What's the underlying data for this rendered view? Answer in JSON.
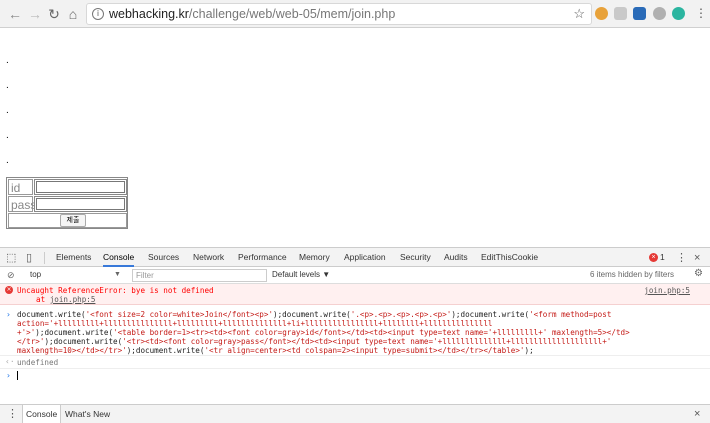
{
  "browser": {
    "url_host": "webhacking.kr",
    "url_path": "/challenge/web/web-05/mem/join.php",
    "back_icon": "arrow-left-icon",
    "forward_icon": "arrow-right-icon",
    "reload_icon": "reload-icon",
    "home_icon": "home-icon",
    "star_icon": "star-icon"
  },
  "page": {
    "dots": [
      ".",
      ".",
      ".",
      ".",
      "."
    ],
    "form": {
      "id_label": "id",
      "pass_label": "pass",
      "submit_label": "제출"
    }
  },
  "devtools": {
    "tabs": [
      "Elements",
      "Console",
      "Sources",
      "Network",
      "Performance",
      "Memory",
      "Application",
      "Security",
      "Audits",
      "EditThisCookie"
    ],
    "active_tab": "Console",
    "error_count": "1",
    "context": "top",
    "filter_placeholder": "Filter",
    "levels": "Default levels ▼",
    "hidden_info": "6 items hidden by filters"
  },
  "console": {
    "error_line1": "Uncaught ReferenceError: bye is not defined",
    "error_at": "at ",
    "error_link": "join.php:5",
    "error_source": "join.php:5",
    "cmd": {
      "l1a": "document.write(",
      "l1b": "'<font size=2 color=white>Join</font><p>'",
      "l1c": ");document.write(",
      "l1d": "'.<p>.<p>.<p>.<p>.<p>'",
      "l1e": ");document.write(",
      "l1f": "'<form method=post",
      "l2": "action='+lllllllll+lllllllllllllll+lllllllll+llllllllllllll+li+llllllllllllllll+llllllll+lllllllllllllll",
      "l3a": "+'>'",
      "l3b": ");document.write(",
      "l3c": "'<table border=1><tr><td><font color=gray>id</font></td><td><input type=text name='",
      "l3d": "+lllllllll+'",
      "l3e": " maxlength=5></td>",
      "l4a": "</tr>'",
      "l4b": ");document.write(",
      "l4c": "'<tr><td><font color=gray>pass</font></td><td><input type=text name='",
      "l4d": "+llllllllllllll+llllllllllllllllllll+'",
      "l5a": "maxlength=10></td></tr>'",
      "l5b": ");document.write(",
      "l5c": "'<tr align=center><td colspan=2><input type=submit></td></tr></table>'",
      "l5d": ");"
    },
    "result": "undefined"
  },
  "drawer": {
    "tabs": [
      "Console",
      "What's New"
    ]
  }
}
